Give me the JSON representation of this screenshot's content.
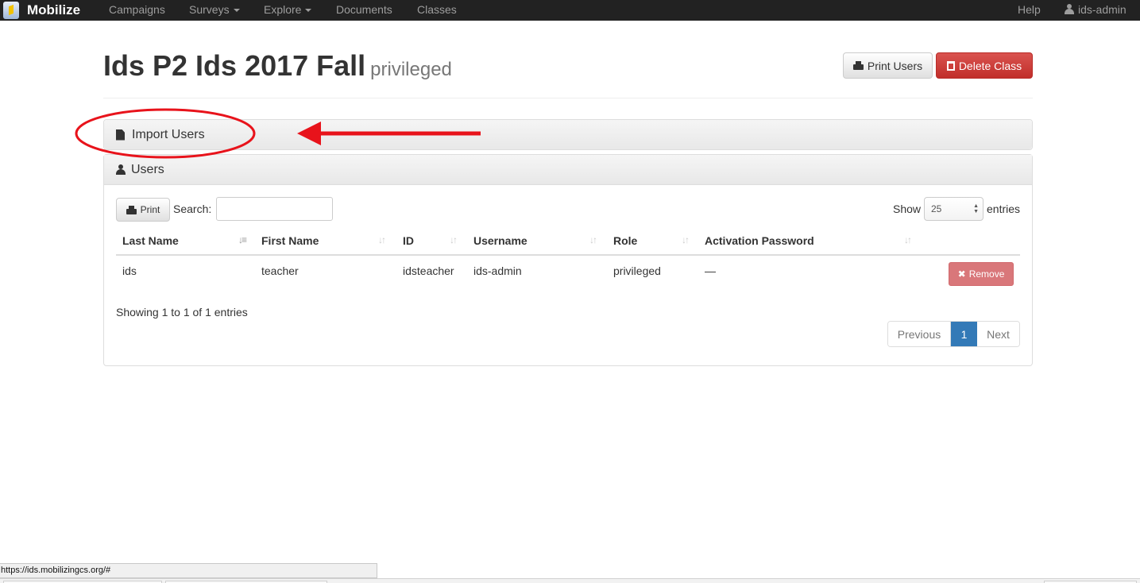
{
  "navbar": {
    "brand": "Mobilize",
    "items": [
      {
        "label": "Campaigns"
      },
      {
        "label": "Surveys"
      },
      {
        "label": "Explore"
      },
      {
        "label": "Documents"
      },
      {
        "label": "Classes"
      }
    ],
    "help": "Help",
    "user": "ids-admin"
  },
  "header": {
    "title": "Ids P2 Ids 2017 Fall",
    "subtitle": "privileged",
    "print_users": "Print Users",
    "delete_class": "Delete Class"
  },
  "import_panel": {
    "title": "Import Users"
  },
  "users_panel": {
    "title": "Users",
    "print_label": "Print",
    "search_label": "Search:",
    "search_value": "",
    "show_label": "Show",
    "page_size": "25",
    "entries_label": "entries",
    "columns": [
      "Last Name",
      "First Name",
      "ID",
      "Username",
      "Role",
      "Activation Password"
    ],
    "rows": [
      {
        "last_name": "ids",
        "first_name": "teacher",
        "id": "idsteacher",
        "username": "ids-admin",
        "role": "privileged",
        "activation_password": "—",
        "action": "Remove"
      }
    ],
    "info": "Showing 1 to 1 of 1 entries",
    "pagination": {
      "previous": "Previous",
      "current": "1",
      "next": "Next"
    }
  },
  "status_bar": {
    "url": "https://ids.mobilizingcs.org/#"
  },
  "colors": {
    "navbar": "#222222",
    "danger": "#d9534f",
    "primary": "#337ab7",
    "annotation": "#e8131b"
  }
}
